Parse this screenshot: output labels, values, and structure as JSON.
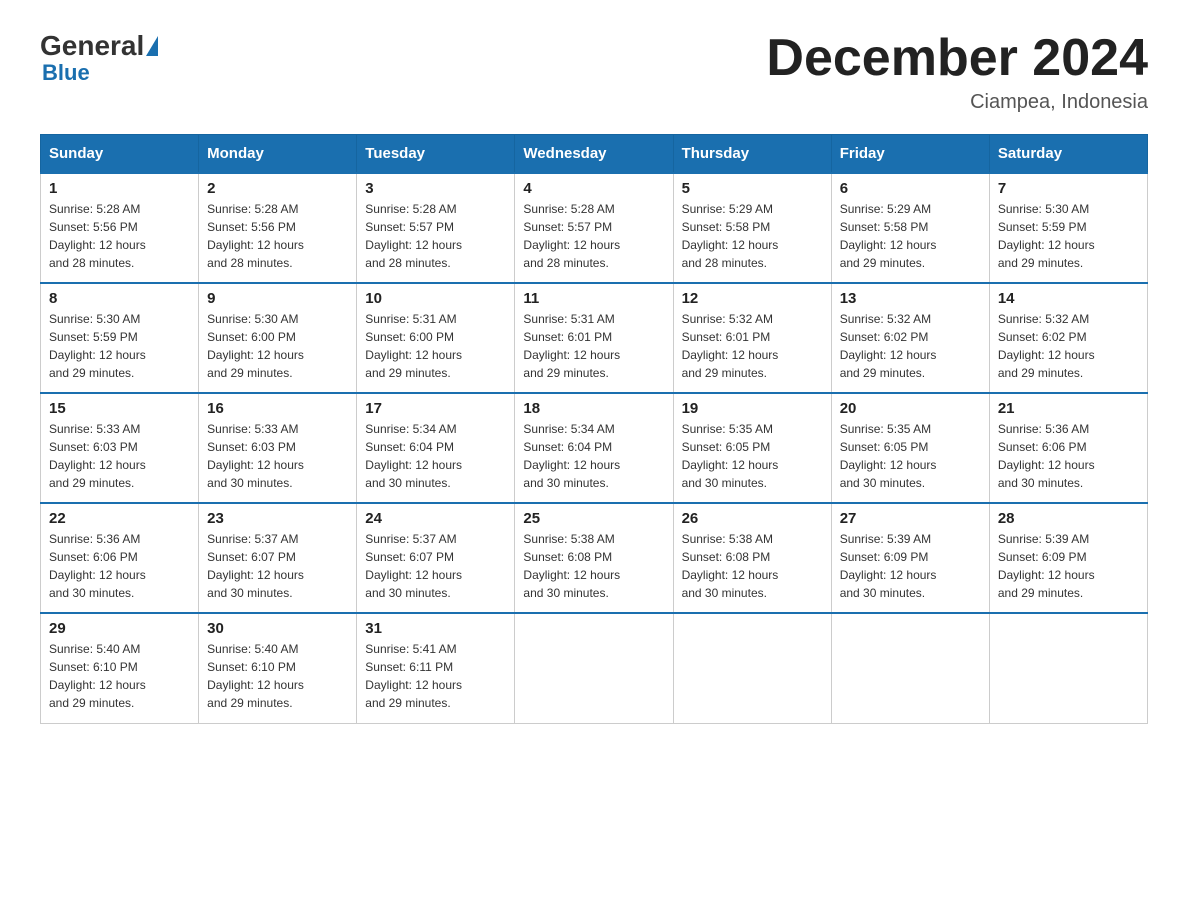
{
  "header": {
    "logo_general": "General",
    "logo_blue": "Blue",
    "month_title": "December 2024",
    "location": "Ciampea, Indonesia"
  },
  "days_of_week": [
    "Sunday",
    "Monday",
    "Tuesday",
    "Wednesday",
    "Thursday",
    "Friday",
    "Saturday"
  ],
  "weeks": [
    [
      {
        "day": "1",
        "sunrise": "5:28 AM",
        "sunset": "5:56 PM",
        "daylight": "12 hours and 28 minutes."
      },
      {
        "day": "2",
        "sunrise": "5:28 AM",
        "sunset": "5:56 PM",
        "daylight": "12 hours and 28 minutes."
      },
      {
        "day": "3",
        "sunrise": "5:28 AM",
        "sunset": "5:57 PM",
        "daylight": "12 hours and 28 minutes."
      },
      {
        "day": "4",
        "sunrise": "5:28 AM",
        "sunset": "5:57 PM",
        "daylight": "12 hours and 28 minutes."
      },
      {
        "day": "5",
        "sunrise": "5:29 AM",
        "sunset": "5:58 PM",
        "daylight": "12 hours and 28 minutes."
      },
      {
        "day": "6",
        "sunrise": "5:29 AM",
        "sunset": "5:58 PM",
        "daylight": "12 hours and 29 minutes."
      },
      {
        "day": "7",
        "sunrise": "5:30 AM",
        "sunset": "5:59 PM",
        "daylight": "12 hours and 29 minutes."
      }
    ],
    [
      {
        "day": "8",
        "sunrise": "5:30 AM",
        "sunset": "5:59 PM",
        "daylight": "12 hours and 29 minutes."
      },
      {
        "day": "9",
        "sunrise": "5:30 AM",
        "sunset": "6:00 PM",
        "daylight": "12 hours and 29 minutes."
      },
      {
        "day": "10",
        "sunrise": "5:31 AM",
        "sunset": "6:00 PM",
        "daylight": "12 hours and 29 minutes."
      },
      {
        "day": "11",
        "sunrise": "5:31 AM",
        "sunset": "6:01 PM",
        "daylight": "12 hours and 29 minutes."
      },
      {
        "day": "12",
        "sunrise": "5:32 AM",
        "sunset": "6:01 PM",
        "daylight": "12 hours and 29 minutes."
      },
      {
        "day": "13",
        "sunrise": "5:32 AM",
        "sunset": "6:02 PM",
        "daylight": "12 hours and 29 minutes."
      },
      {
        "day": "14",
        "sunrise": "5:32 AM",
        "sunset": "6:02 PM",
        "daylight": "12 hours and 29 minutes."
      }
    ],
    [
      {
        "day": "15",
        "sunrise": "5:33 AM",
        "sunset": "6:03 PM",
        "daylight": "12 hours and 29 minutes."
      },
      {
        "day": "16",
        "sunrise": "5:33 AM",
        "sunset": "6:03 PM",
        "daylight": "12 hours and 30 minutes."
      },
      {
        "day": "17",
        "sunrise": "5:34 AM",
        "sunset": "6:04 PM",
        "daylight": "12 hours and 30 minutes."
      },
      {
        "day": "18",
        "sunrise": "5:34 AM",
        "sunset": "6:04 PM",
        "daylight": "12 hours and 30 minutes."
      },
      {
        "day": "19",
        "sunrise": "5:35 AM",
        "sunset": "6:05 PM",
        "daylight": "12 hours and 30 minutes."
      },
      {
        "day": "20",
        "sunrise": "5:35 AM",
        "sunset": "6:05 PM",
        "daylight": "12 hours and 30 minutes."
      },
      {
        "day": "21",
        "sunrise": "5:36 AM",
        "sunset": "6:06 PM",
        "daylight": "12 hours and 30 minutes."
      }
    ],
    [
      {
        "day": "22",
        "sunrise": "5:36 AM",
        "sunset": "6:06 PM",
        "daylight": "12 hours and 30 minutes."
      },
      {
        "day": "23",
        "sunrise": "5:37 AM",
        "sunset": "6:07 PM",
        "daylight": "12 hours and 30 minutes."
      },
      {
        "day": "24",
        "sunrise": "5:37 AM",
        "sunset": "6:07 PM",
        "daylight": "12 hours and 30 minutes."
      },
      {
        "day": "25",
        "sunrise": "5:38 AM",
        "sunset": "6:08 PM",
        "daylight": "12 hours and 30 minutes."
      },
      {
        "day": "26",
        "sunrise": "5:38 AM",
        "sunset": "6:08 PM",
        "daylight": "12 hours and 30 minutes."
      },
      {
        "day": "27",
        "sunrise": "5:39 AM",
        "sunset": "6:09 PM",
        "daylight": "12 hours and 30 minutes."
      },
      {
        "day": "28",
        "sunrise": "5:39 AM",
        "sunset": "6:09 PM",
        "daylight": "12 hours and 29 minutes."
      }
    ],
    [
      {
        "day": "29",
        "sunrise": "5:40 AM",
        "sunset": "6:10 PM",
        "daylight": "12 hours and 29 minutes."
      },
      {
        "day": "30",
        "sunrise": "5:40 AM",
        "sunset": "6:10 PM",
        "daylight": "12 hours and 29 minutes."
      },
      {
        "day": "31",
        "sunrise": "5:41 AM",
        "sunset": "6:11 PM",
        "daylight": "12 hours and 29 minutes."
      },
      null,
      null,
      null,
      null
    ]
  ],
  "labels": {
    "sunrise": "Sunrise:",
    "sunset": "Sunset:",
    "daylight": "Daylight:"
  }
}
